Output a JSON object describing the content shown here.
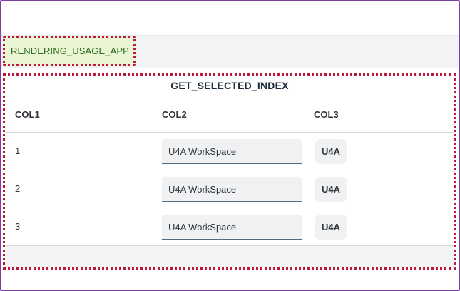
{
  "app": {
    "name": "RENDERING_USAGE_APP"
  },
  "panel": {
    "title": "GET_SELECTED_INDEX",
    "columns": [
      "COL1",
      "COL2",
      "COL3"
    ],
    "rows": [
      {
        "col1": "1",
        "col2": "U4A WorkSpace",
        "col3": "U4A"
      },
      {
        "col1": "2",
        "col2": "U4A WorkSpace",
        "col3": "U4A"
      },
      {
        "col1": "3",
        "col2": "U4A WorkSpace",
        "col3": "U4A"
      }
    ]
  },
  "colors": {
    "frame": "#7b3fa0",
    "highlight": "#c0143c",
    "tag_bg": "#eaf5d3",
    "tag_text": "#2e6b1f"
  }
}
